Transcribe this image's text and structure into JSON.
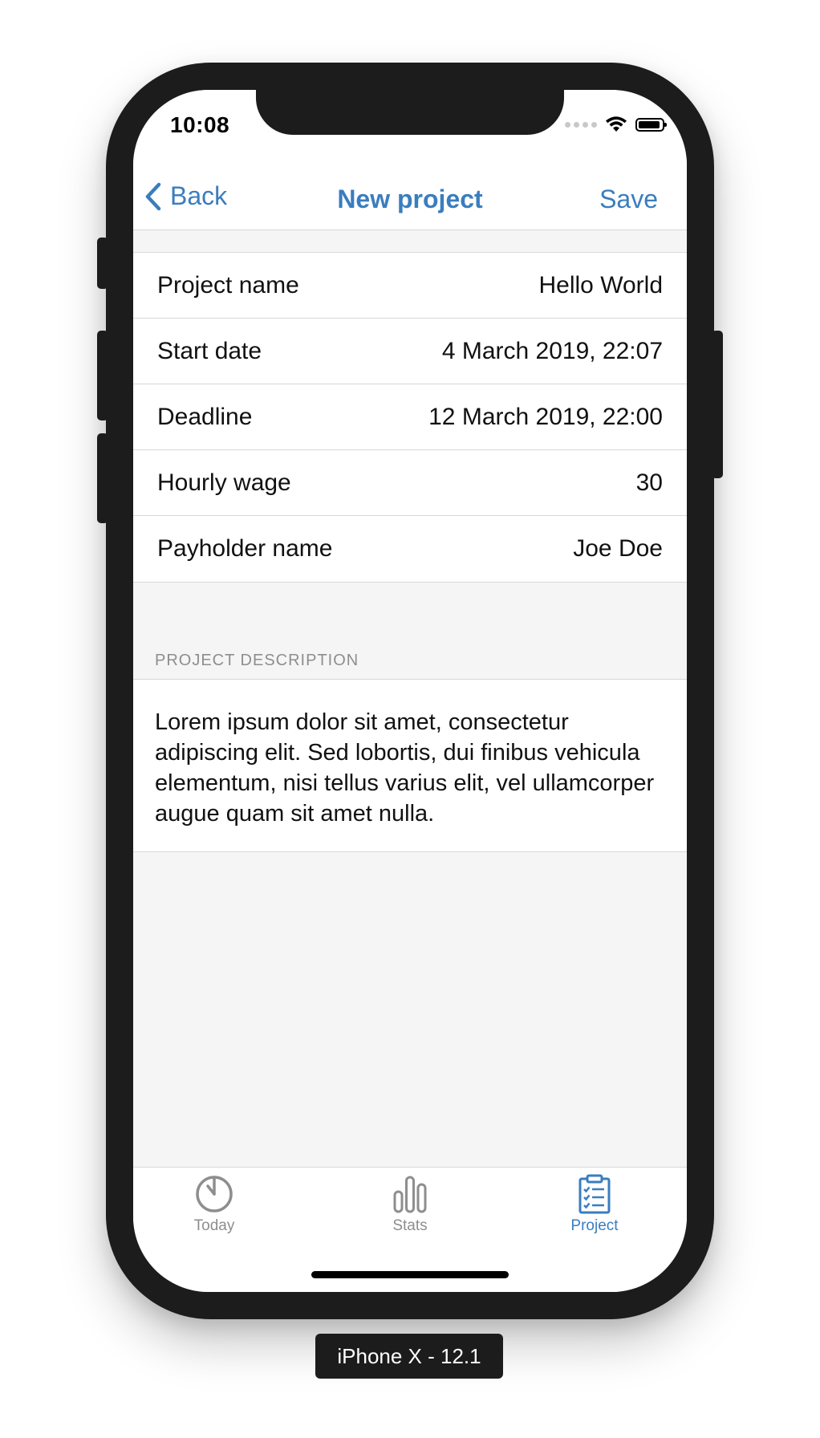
{
  "status_bar": {
    "time": "10:08"
  },
  "nav": {
    "back_label": "Back",
    "title": "New project",
    "save_label": "Save"
  },
  "form": {
    "rows": [
      {
        "label": "Project name",
        "value": "Hello World"
      },
      {
        "label": "Start date",
        "value": "4 March 2019, 22:07"
      },
      {
        "label": "Deadline",
        "value": "12 March 2019, 22:00"
      },
      {
        "label": "Hourly wage",
        "value": "30"
      },
      {
        "label": "Payholder name",
        "value": "Joe Doe"
      }
    ]
  },
  "description": {
    "header": "PROJECT DESCRIPTION",
    "text": "Lorem ipsum dolor sit amet, consectetur adipiscing elit. Sed lobortis, dui finibus vehicula elementum, nisi tellus varius elit, vel ullamcorper augue quam sit amet nulla."
  },
  "tabs": [
    {
      "label": "Today",
      "icon": "timer-icon",
      "active": false
    },
    {
      "label": "Stats",
      "icon": "bar-chart-icon",
      "active": false
    },
    {
      "label": "Project",
      "icon": "clipboard-checklist-icon",
      "active": true
    }
  ],
  "colors": {
    "accent": "#3a7dbf",
    "inactive": "#8e8e8e",
    "background": "#f5f5f5",
    "device": "#1c1c1c"
  },
  "device_label": "iPhone X - 12.1"
}
